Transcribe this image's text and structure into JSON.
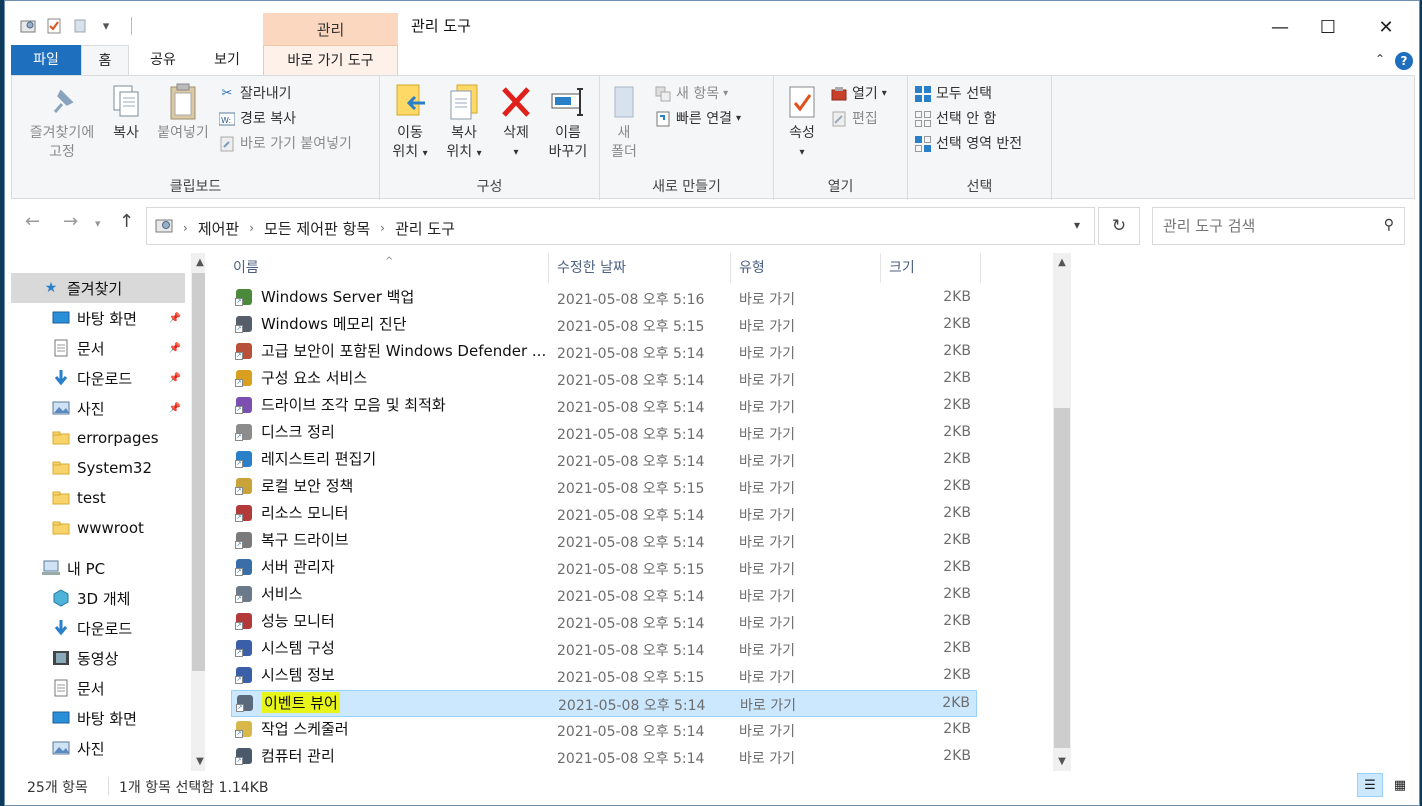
{
  "window": {
    "title": "관리 도구",
    "context_tab_group": "관리",
    "minimize": "—",
    "maximize": "☐",
    "close": "✕"
  },
  "tabs": [
    {
      "label": "파일"
    },
    {
      "label": "홈"
    },
    {
      "label": "공유"
    },
    {
      "label": "보기"
    },
    {
      "label": "바로 가기 도구"
    }
  ],
  "help_label": "?",
  "ribbon": {
    "clipboard": {
      "label": "클립보드",
      "pin_line1": "즐겨찾기에",
      "pin_line2": "고정",
      "copy": "복사",
      "paste": "붙여넣기",
      "cut": "잘라내기",
      "copy_path": "경로 복사",
      "paste_shortcut": "바로 가기 붙여넣기"
    },
    "organize": {
      "label": "구성",
      "move_line1": "이동",
      "move_line2": "위치",
      "copyto_line1": "복사",
      "copyto_line2": "위치",
      "delete": "삭제",
      "rename_line1": "이름",
      "rename_line2": "바꾸기"
    },
    "new": {
      "label": "새로 만들기",
      "folder_line1": "새",
      "folder_line2": "폴더",
      "new_item": "새 항목",
      "easy_access": "빠른 연결"
    },
    "open": {
      "label": "열기",
      "properties": "속성",
      "open": "열기",
      "edit": "편집"
    },
    "select": {
      "label": "선택",
      "select_all": "모두 선택",
      "select_none": "선택 안 함",
      "invert": "선택 영역 반전"
    }
  },
  "address": {
    "crumbs": [
      "제어판",
      "모든 제어판 항목",
      "관리 도구"
    ]
  },
  "search": {
    "placeholder": "관리 도구 검색"
  },
  "nav": {
    "quick_access": "즐겨찾기",
    "items": [
      {
        "label": "바탕 화면",
        "icon": "desktop-icon",
        "pinned": true
      },
      {
        "label": "문서",
        "icon": "document-icon",
        "pinned": true
      },
      {
        "label": "다운로드",
        "icon": "download-icon",
        "pinned": true
      },
      {
        "label": "사진",
        "icon": "picture-icon",
        "pinned": true
      },
      {
        "label": "errorpages",
        "icon": "folder-icon",
        "pinned": false
      },
      {
        "label": "System32",
        "icon": "folder-icon",
        "pinned": false
      },
      {
        "label": "test",
        "icon": "folder-icon",
        "pinned": false
      },
      {
        "label": "wwwroot",
        "icon": "folder-icon",
        "pinned": false
      }
    ],
    "this_pc": "내 PC",
    "pc_items": [
      {
        "label": "3D 개체",
        "icon": "cube-icon"
      },
      {
        "label": "다운로드",
        "icon": "download-icon"
      },
      {
        "label": "동영상",
        "icon": "video-icon"
      },
      {
        "label": "문서",
        "icon": "document-icon"
      },
      {
        "label": "바탕 화면",
        "icon": "desktop-icon"
      },
      {
        "label": "사진",
        "icon": "picture-icon"
      }
    ]
  },
  "columns": {
    "name": "이름",
    "date": "수정한 날짜",
    "type": "유형",
    "size": "크기"
  },
  "files": [
    {
      "name": "Windows Server 백업",
      "date": "2021-05-08 오후 5:16",
      "type": "바로 가기",
      "size": "2KB",
      "color": "#4a8a3a"
    },
    {
      "name": "Windows 메모리 진단",
      "date": "2021-05-08 오후 5:15",
      "type": "바로 가기",
      "size": "2KB",
      "color": "#555e6a"
    },
    {
      "name": "고급 보안이 포함된 Windows Defender ...",
      "date": "2021-05-08 오후 5:14",
      "type": "바로 가기",
      "size": "2KB",
      "color": "#b8513a"
    },
    {
      "name": "구성 요소 서비스",
      "date": "2021-05-08 오후 5:14",
      "type": "바로 가기",
      "size": "2KB",
      "color": "#d8a01e"
    },
    {
      "name": "드라이브 조각 모음 및 최적화",
      "date": "2021-05-08 오후 5:14",
      "type": "바로 가기",
      "size": "2KB",
      "color": "#7a4fb0"
    },
    {
      "name": "디스크 정리",
      "date": "2021-05-08 오후 5:14",
      "type": "바로 가기",
      "size": "2KB",
      "color": "#8c8c8c"
    },
    {
      "name": "레지스트리 편집기",
      "date": "2021-05-08 오후 5:14",
      "type": "바로 가기",
      "size": "2KB",
      "color": "#2a7fc9"
    },
    {
      "name": "로컬 보안 정책",
      "date": "2021-05-08 오후 5:15",
      "type": "바로 가기",
      "size": "2KB",
      "color": "#c9a23a"
    },
    {
      "name": "리소스 모니터",
      "date": "2021-05-08 오후 5:14",
      "type": "바로 가기",
      "size": "2KB",
      "color": "#b33a3a"
    },
    {
      "name": "복구 드라이브",
      "date": "2021-05-08 오후 5:14",
      "type": "바로 가기",
      "size": "2KB",
      "color": "#7a7a7a"
    },
    {
      "name": "서버 관리자",
      "date": "2021-05-08 오후 5:15",
      "type": "바로 가기",
      "size": "2KB",
      "color": "#3a6ea8"
    },
    {
      "name": "서비스",
      "date": "2021-05-08 오후 5:14",
      "type": "바로 가기",
      "size": "2KB",
      "color": "#6a7a8a"
    },
    {
      "name": "성능 모니터",
      "date": "2021-05-08 오후 5:14",
      "type": "바로 가기",
      "size": "2KB",
      "color": "#b33a3a"
    },
    {
      "name": "시스템 구성",
      "date": "2021-05-08 오후 5:14",
      "type": "바로 가기",
      "size": "2KB",
      "color": "#3a5fa8"
    },
    {
      "name": "시스템 정보",
      "date": "2021-05-08 오후 5:15",
      "type": "바로 가기",
      "size": "2KB",
      "color": "#3a5fa8"
    },
    {
      "name": "이벤트 뷰어",
      "date": "2021-05-08 오후 5:14",
      "type": "바로 가기",
      "size": "2KB",
      "color": "#5a6a7a",
      "selected": true
    },
    {
      "name": "작업 스케줄러",
      "date": "2021-05-08 오후 5:14",
      "type": "바로 가기",
      "size": "2KB",
      "color": "#d8b84a"
    },
    {
      "name": "컴퓨터 관리",
      "date": "2021-05-08 오후 5:14",
      "type": "바로 가기",
      "size": "2KB",
      "color": "#4a5a6a"
    }
  ],
  "status": {
    "count": "25개 항목",
    "selection": "1개 항목 선택함 1.14KB"
  },
  "colors": {
    "file_tab": "#1f6fbf",
    "context_tab": "#fbd7c0",
    "selection": "#cce8ff",
    "highlight": "#e8f51a",
    "delete_red": "#e0201a"
  }
}
